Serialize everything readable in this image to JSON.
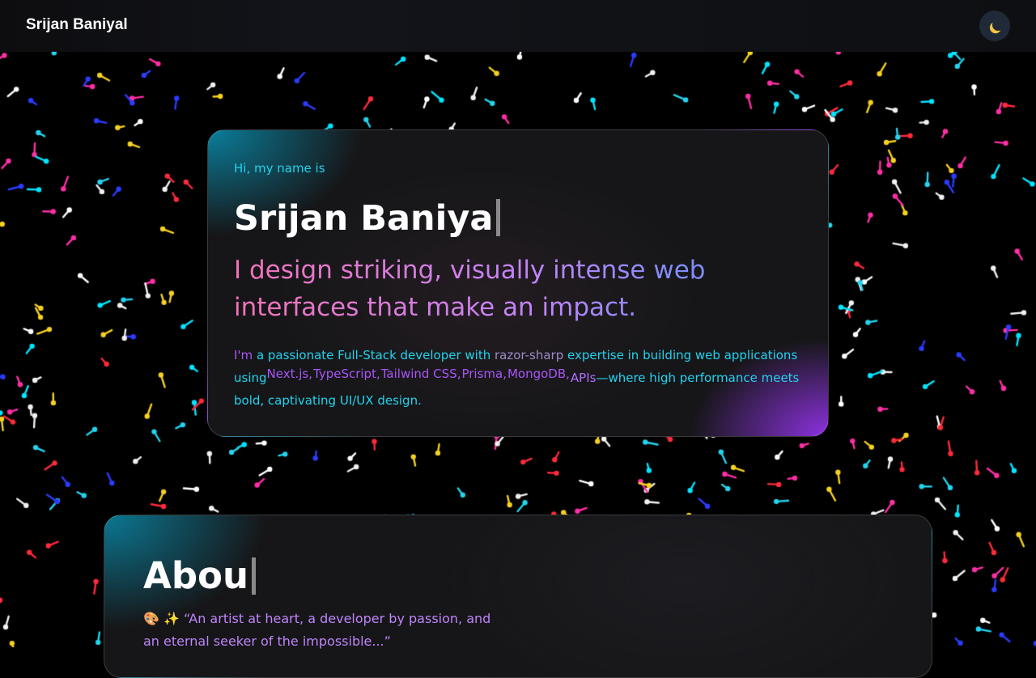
{
  "navbar": {
    "brand": "Srijan Baniyal",
    "theme_toggle_icon": "moon-icon"
  },
  "hero": {
    "greeting": "Hi, my name is",
    "name_typed": "Srijan Baniya",
    "tagline": "I design striking, visually intense web interfaces that make an impact.",
    "intro": {
      "part1": "I'm",
      "part2": " a passionate Full-Stack developer with ",
      "highlight": "razor-sharp",
      "part3": " expertise in building web applications using",
      "techs": [
        "Next.js,",
        "TypeScript,",
        "Tailwind CSS,",
        "Prisma,",
        "MongoDB,"
      ],
      "apis": "APIs",
      "part4": "—where high performance meets bold, captivating UI/UX design."
    }
  },
  "about": {
    "title_typed": "Abou",
    "emojis": "🎨 ✨",
    "quote": "“An artist at heart, a developer by passion, and an eternal seeker of the impossible...”"
  },
  "theme": {
    "accent_cyan": "#22d3ee",
    "accent_purple": "#a855f7",
    "accent_pink": "#f472b6",
    "background": "#000000"
  }
}
